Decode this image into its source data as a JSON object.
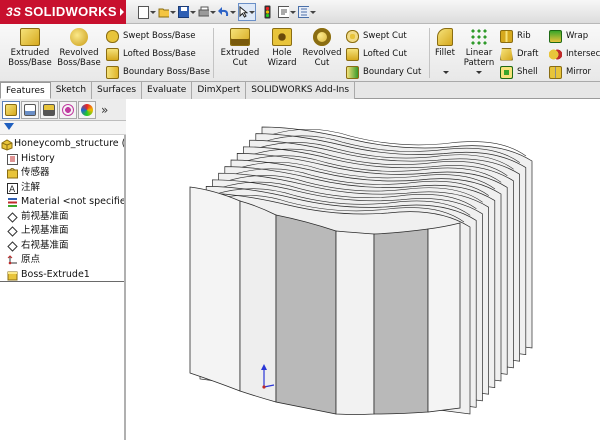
{
  "app": {
    "logo_ds": "3S",
    "logo_text": "SOLIDWORKS"
  },
  "quick_access": [
    {
      "name": "new-document-icon",
      "glyph": "▫"
    },
    {
      "name": "open-folder-icon",
      "glyph": "📂"
    },
    {
      "name": "save-icon",
      "glyph": "💾"
    },
    {
      "name": "print-icon",
      "glyph": "🖶"
    },
    {
      "name": "undo-icon",
      "glyph": "↶"
    },
    {
      "name": "select-pointer-icon",
      "glyph": "↖"
    },
    {
      "name": "rebuild-traffic-light-icon",
      "glyph": "🚦"
    },
    {
      "name": "file-properties-icon",
      "glyph": "📝"
    },
    {
      "name": "options-icon",
      "glyph": "☑"
    }
  ],
  "ribbon": {
    "extruded_boss": "Extruded\nBoss/Base",
    "revolved_boss": "Revolved\nBoss/Base",
    "swept_boss": "Swept Boss/Base",
    "lofted_boss": "Lofted Boss/Base",
    "boundary_boss": "Boundary Boss/Base",
    "extruded_cut": "Extruded\nCut",
    "hole_wizard": "Hole\nWizard",
    "revolved_cut": "Revolved\nCut",
    "swept_cut": "Swept Cut",
    "lofted_cut": "Lofted Cut",
    "boundary_cut": "Boundary Cut",
    "fillet": "Fillet",
    "linear_pattern": "Linear\nPattern",
    "rib": "Rib",
    "draft": "Draft",
    "shell": "Shell",
    "wrap": "Wrap",
    "intersect": "Intersect",
    "mirror": "Mirror"
  },
  "tabs": [
    "Features",
    "Sketch",
    "Surfaces",
    "Evaluate",
    "DimXpert",
    "SOLIDWORKS Add-Ins"
  ],
  "active_tab": "Features",
  "tree": {
    "root": "Honeycomb_structure (默",
    "items": [
      {
        "label": "History",
        "icon": "history-icon"
      },
      {
        "label": "传感器",
        "icon": "sensors-icon"
      },
      {
        "label": "注解",
        "icon": "annotations-icon"
      },
      {
        "label": "Material <not specified>",
        "icon": "material-icon"
      },
      {
        "label": "前视基准面",
        "icon": "plane-icon"
      },
      {
        "label": "上视基准面",
        "icon": "plane-icon"
      },
      {
        "label": "右视基准面",
        "icon": "plane-icon"
      },
      {
        "label": "原点",
        "icon": "origin-icon"
      },
      {
        "label": "Boss-Extrude1",
        "icon": "extrude-feature-icon"
      }
    ]
  },
  "colors": {
    "brand_red": "#c8102e",
    "face_light": "#f2f2f2",
    "face_dark": "#b8b8b8",
    "edge": "#2a2a2a"
  }
}
